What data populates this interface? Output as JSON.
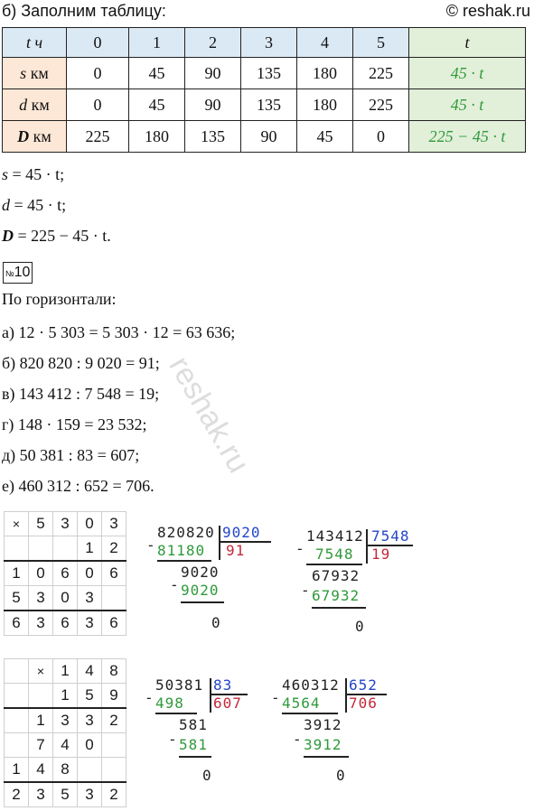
{
  "header": {
    "title": "б) Заполним таблицу:",
    "source": "© reshak.ru"
  },
  "table": {
    "header": [
      "t ч",
      "0",
      "1",
      "2",
      "3",
      "4",
      "5",
      "t"
    ],
    "rows": [
      {
        "var": "s",
        "unit": "км",
        "values": [
          "0",
          "45",
          "90",
          "135",
          "180",
          "225"
        ],
        "formula": "45 · t"
      },
      {
        "var": "d",
        "unit": "км",
        "values": [
          "0",
          "45",
          "90",
          "135",
          "180",
          "225"
        ],
        "formula": "45 · t"
      },
      {
        "var": "D",
        "unit": "км",
        "values": [
          "225",
          "180",
          "135",
          "90",
          "45",
          "0"
        ],
        "formula": "225 − 45 · t"
      }
    ]
  },
  "formulas": [
    {
      "var": "s",
      "rest": " = 45 · t;"
    },
    {
      "var": "d",
      "rest": " = 45 · t;"
    },
    {
      "var": "D",
      "rest": " = 225 − 45 · t."
    }
  ],
  "task": {
    "badge_prefix": "№",
    "number": "10",
    "heading": "По горизонтали:"
  },
  "answers": [
    "а) 12 · 5 303 = 5 303 · 12 = 63 636;",
    "б) 820 820 : 9 020 = 91;",
    "в) 143 412 : 7 548 = 19;",
    "г) 148 · 159 = 23 532;",
    "д) 50 381 : 83 = 607;",
    "е) 460 312 : 652 = 706."
  ],
  "mult1": [
    [
      "×",
      "5",
      "3",
      "0",
      "3"
    ],
    [
      "",
      "",
      "",
      "1",
      "2"
    ],
    [
      "1",
      "0",
      "6",
      "0",
      "6"
    ],
    [
      "5",
      "3",
      "0",
      "3",
      ""
    ],
    [
      "6",
      "3",
      "6",
      "3",
      "6"
    ]
  ],
  "mult2": [
    [
      "",
      "×",
      "1",
      "4",
      "8"
    ],
    [
      "",
      "",
      "1",
      "5",
      "9"
    ],
    [
      "",
      "1",
      "3",
      "3",
      "2"
    ],
    [
      "",
      "7",
      "4",
      "0",
      ""
    ],
    [
      "1",
      "4",
      "8",
      "",
      ""
    ],
    [
      "2",
      "3",
      "5",
      "3",
      "2"
    ]
  ],
  "divisions": [
    {
      "dividend": "820820",
      "divisor": "9020",
      "sub1": "81180",
      "quotient": "91",
      "rem1": "9020",
      "sub2": "9020",
      "result": "0"
    },
    {
      "dividend": "143412",
      "divisor": "7548",
      "sub1": "7548",
      "quotient": "19",
      "rem1": "67932",
      "sub2": "67932",
      "result": "0"
    },
    {
      "dividend": "50381",
      "divisor": "83",
      "sub1": "498",
      "quotient": "607",
      "rem1": "581",
      "sub2": "581",
      "result": "0"
    },
    {
      "dividend": "460312",
      "divisor": "652",
      "sub1": "4564",
      "quotient": "706",
      "rem1": "3912",
      "sub2": "3912",
      "result": "0"
    }
  ],
  "watermark": "reshak.ru"
}
